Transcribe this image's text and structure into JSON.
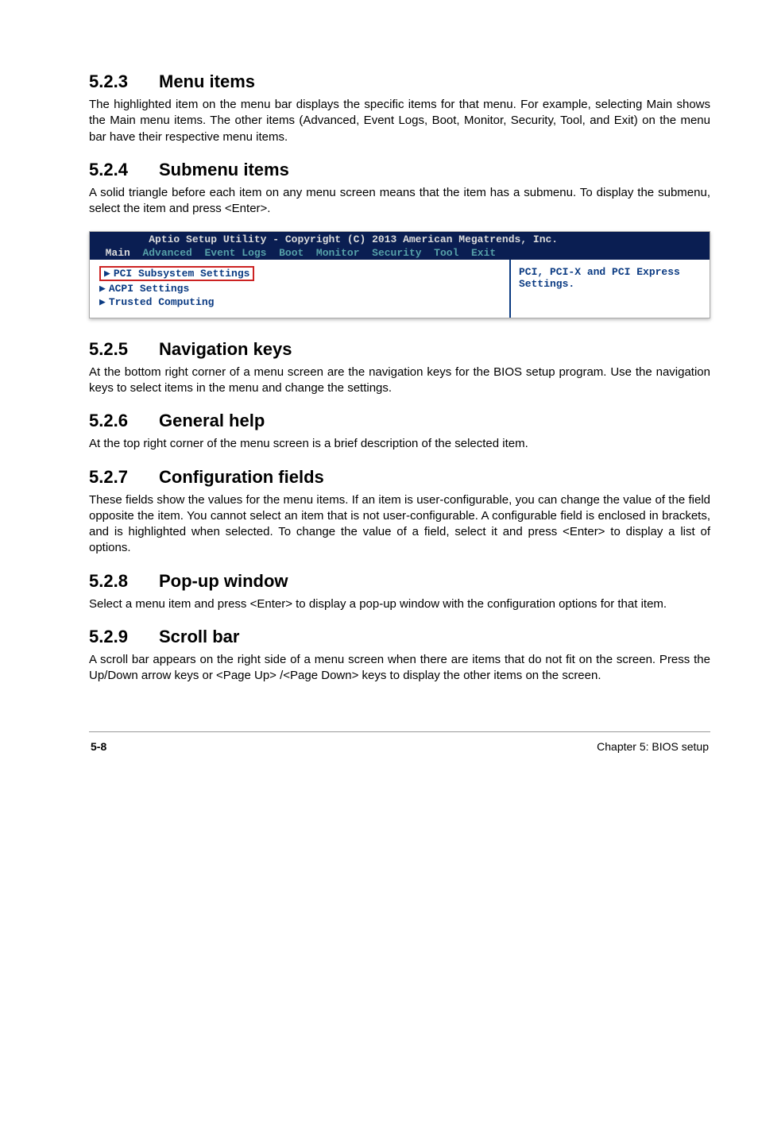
{
  "s523": {
    "heading_num": "5.2.3",
    "heading_title": "Menu items",
    "para": "The highlighted item on the menu bar displays the specific items for that menu. For example, selecting Main shows the Main menu items. The other items (Advanced, Event Logs, Boot, Monitor, Security, Tool, and Exit) on the menu bar have their respective menu items."
  },
  "s524": {
    "heading_num": "5.2.4",
    "heading_title": "Submenu items",
    "para": "A solid triangle before each item on any menu screen means that the item has a submenu. To display the submenu, select the item and press <Enter>."
  },
  "bios": {
    "title": "Aptio Setup Utility - Copyright (C) 2013 American Megatrends, Inc.",
    "tabs": {
      "main": "Main",
      "advanced": "Advanced",
      "eventlogs": "Event Logs",
      "boot": "Boot",
      "monitor": "Monitor",
      "security": "Security",
      "tool": "Tool",
      "exit": "Exit"
    },
    "items": {
      "pci": "PCI Subsystem Settings",
      "acpi": "ACPI Settings",
      "trusted": "Trusted Computing"
    },
    "help": "PCI, PCI-X and PCI Express Settings."
  },
  "s525": {
    "heading_num": "5.2.5",
    "heading_title": "Navigation keys",
    "para": "At the bottom right corner of a menu screen are the navigation keys for the BIOS setup program. Use the navigation keys to select items in the menu and change the settings."
  },
  "s526": {
    "heading_num": "5.2.6",
    "heading_title": "General help",
    "para": "At the top right corner of the menu screen is a brief description of the selected item."
  },
  "s527": {
    "heading_num": "5.2.7",
    "heading_title": "Configuration fields",
    "para": "These fields show the values for the menu items. If an item is user-configurable, you can change the value of the field opposite the item. You cannot select an item that is not user-configurable. A configurable field is enclosed in brackets, and is highlighted when selected. To change the value of a field, select it and press <Enter> to display a list of options."
  },
  "s528": {
    "heading_num": "5.2.8",
    "heading_title": "Pop-up window",
    "para": "Select a menu item and press <Enter> to display a pop-up window with the configuration options for that item."
  },
  "s529": {
    "heading_num": "5.2.9",
    "heading_title": "Scroll bar",
    "para": "A scroll bar appears on the right side of a menu screen when there are items that do not fit on the screen. Press the Up/Down arrow keys or <Page Up> /<Page Down> keys to display the other items on the screen."
  },
  "footer": {
    "page": "5-8",
    "chapter": "Chapter 5: BIOS setup"
  }
}
